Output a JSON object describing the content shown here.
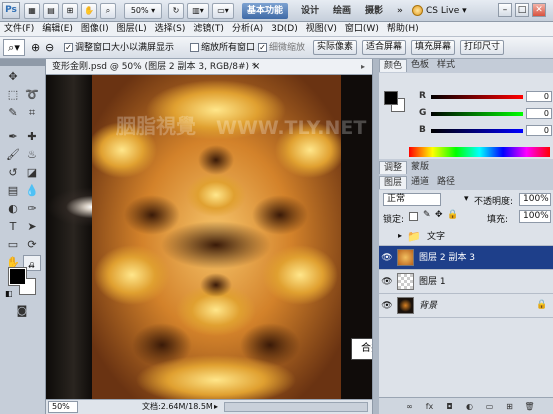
{
  "titlebar": {
    "logo": "Ps",
    "zoom": "50%",
    "workspaces": [
      "基本功能",
      "设计",
      "绘画",
      "摄影"
    ],
    "more": "»",
    "cs_live": "CS Live",
    "minimize": "–",
    "maximize": "□",
    "close": "✕"
  },
  "menu": [
    "文件(F)",
    "编辑(E)",
    "图像(I)",
    "图层(L)",
    "选择(S)",
    "滤镜(T)",
    "分析(A)",
    "3D(D)",
    "视图(V)",
    "窗口(W)",
    "帮助(H)"
  ],
  "options": {
    "resize_windows": "调整窗口大小以满屏显示",
    "zoom_all": "缩放所有窗口",
    "scrubby": "细微缩放",
    "actual_pixels": "实际像素",
    "fit_screen": "适合屏幕",
    "fill_screen": "填充屏幕",
    "print_size": "打印尺寸"
  },
  "document": {
    "title": "变形金刚.psd @ 50% (图层 2 副本 3, RGB/8#) *",
    "close": "×",
    "zoom": "50%",
    "info": "文档:2.64M/18.5M",
    "watermark": "WWW.TLY.NET",
    "watermark_cn": "胭脂視覺"
  },
  "tooltip": "合并图层调整色调",
  "color_panel": {
    "tabs": [
      "颜色",
      "色板",
      "样式"
    ],
    "r_label": "R",
    "r_value": "0",
    "g_label": "G",
    "g_value": "0",
    "b_label": "B",
    "b_value": "0"
  },
  "adjust_tabs": [
    "调整",
    "蒙版"
  ],
  "layers_panel": {
    "tabs": [
      "图层",
      "通道",
      "路径"
    ],
    "blend_mode": "正常",
    "opacity_label": "不透明度:",
    "opacity_value": "100%",
    "lock_label": "锁定:",
    "fill_label": "填充:",
    "fill_value": "100%",
    "layers": [
      {
        "name": "文字",
        "type": "group",
        "visible": false,
        "selected": false
      },
      {
        "name": "图层 2 副本 3",
        "type": "layer",
        "visible": true,
        "selected": true
      },
      {
        "name": "图层 1",
        "type": "layer",
        "visible": true,
        "selected": false
      },
      {
        "name": "背景",
        "type": "background",
        "visible": true,
        "selected": false
      }
    ]
  },
  "colors": {
    "accent": "#1e3f8a",
    "foreground": "#000000",
    "background": "#ffffff"
  }
}
